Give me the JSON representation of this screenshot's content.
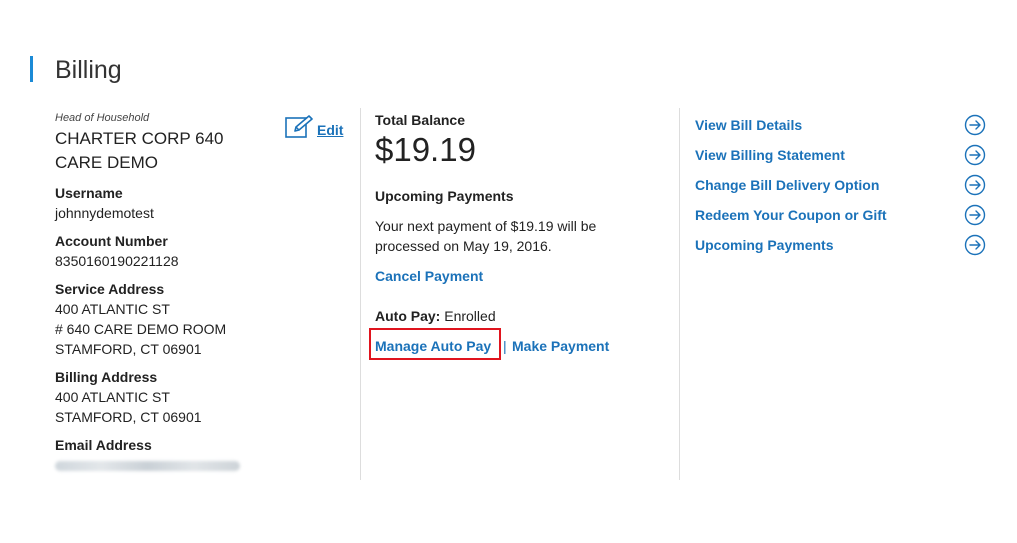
{
  "header": {
    "title": "Billing"
  },
  "account": {
    "hoh_label": "Head of Household",
    "name": "CHARTER CORP 640 CARE DEMO",
    "edit_label": "Edit",
    "username_label": "Username",
    "username": "johnnydemotest",
    "account_number_label": "Account Number",
    "account_number": "8350160190221128",
    "service_address_label": "Service Address",
    "service_address": [
      "400 ATLANTIC ST",
      "# 640 CARE DEMO ROOM",
      "STAMFORD, CT 06901"
    ],
    "billing_address_label": "Billing Address",
    "billing_address": [
      "400 ATLANTIC ST",
      "STAMFORD, CT 06901"
    ],
    "email_label": "Email Address"
  },
  "balance": {
    "total_label": "Total Balance",
    "amount": "$19.19",
    "upcoming_label": "Upcoming Payments",
    "upcoming_text": "Your next payment of $19.19 will be processed on May 19, 2016.",
    "cancel_label": "Cancel Payment",
    "autopay_label": "Auto Pay:",
    "autopay_status": "Enrolled",
    "manage_autopay_label": "Manage Auto Pay",
    "separator": "|",
    "make_payment_label": "Make Payment"
  },
  "links": [
    {
      "label": "View Bill Details",
      "icon": "arrow-circle-right-icon"
    },
    {
      "label": "View Billing Statement",
      "icon": "arrow-circle-right-icon"
    },
    {
      "label": "Change Bill Delivery Option",
      "icon": "arrow-circle-right-icon"
    },
    {
      "label": "Redeem Your Coupon or Gift",
      "icon": "arrow-circle-right-icon"
    },
    {
      "label": "Upcoming Payments",
      "icon": "arrow-circle-right-icon"
    }
  ],
  "colors": {
    "accent": "#1b8ad6",
    "link": "#1b72b9",
    "highlight": "#e0141e",
    "divider": "#dddddd"
  }
}
